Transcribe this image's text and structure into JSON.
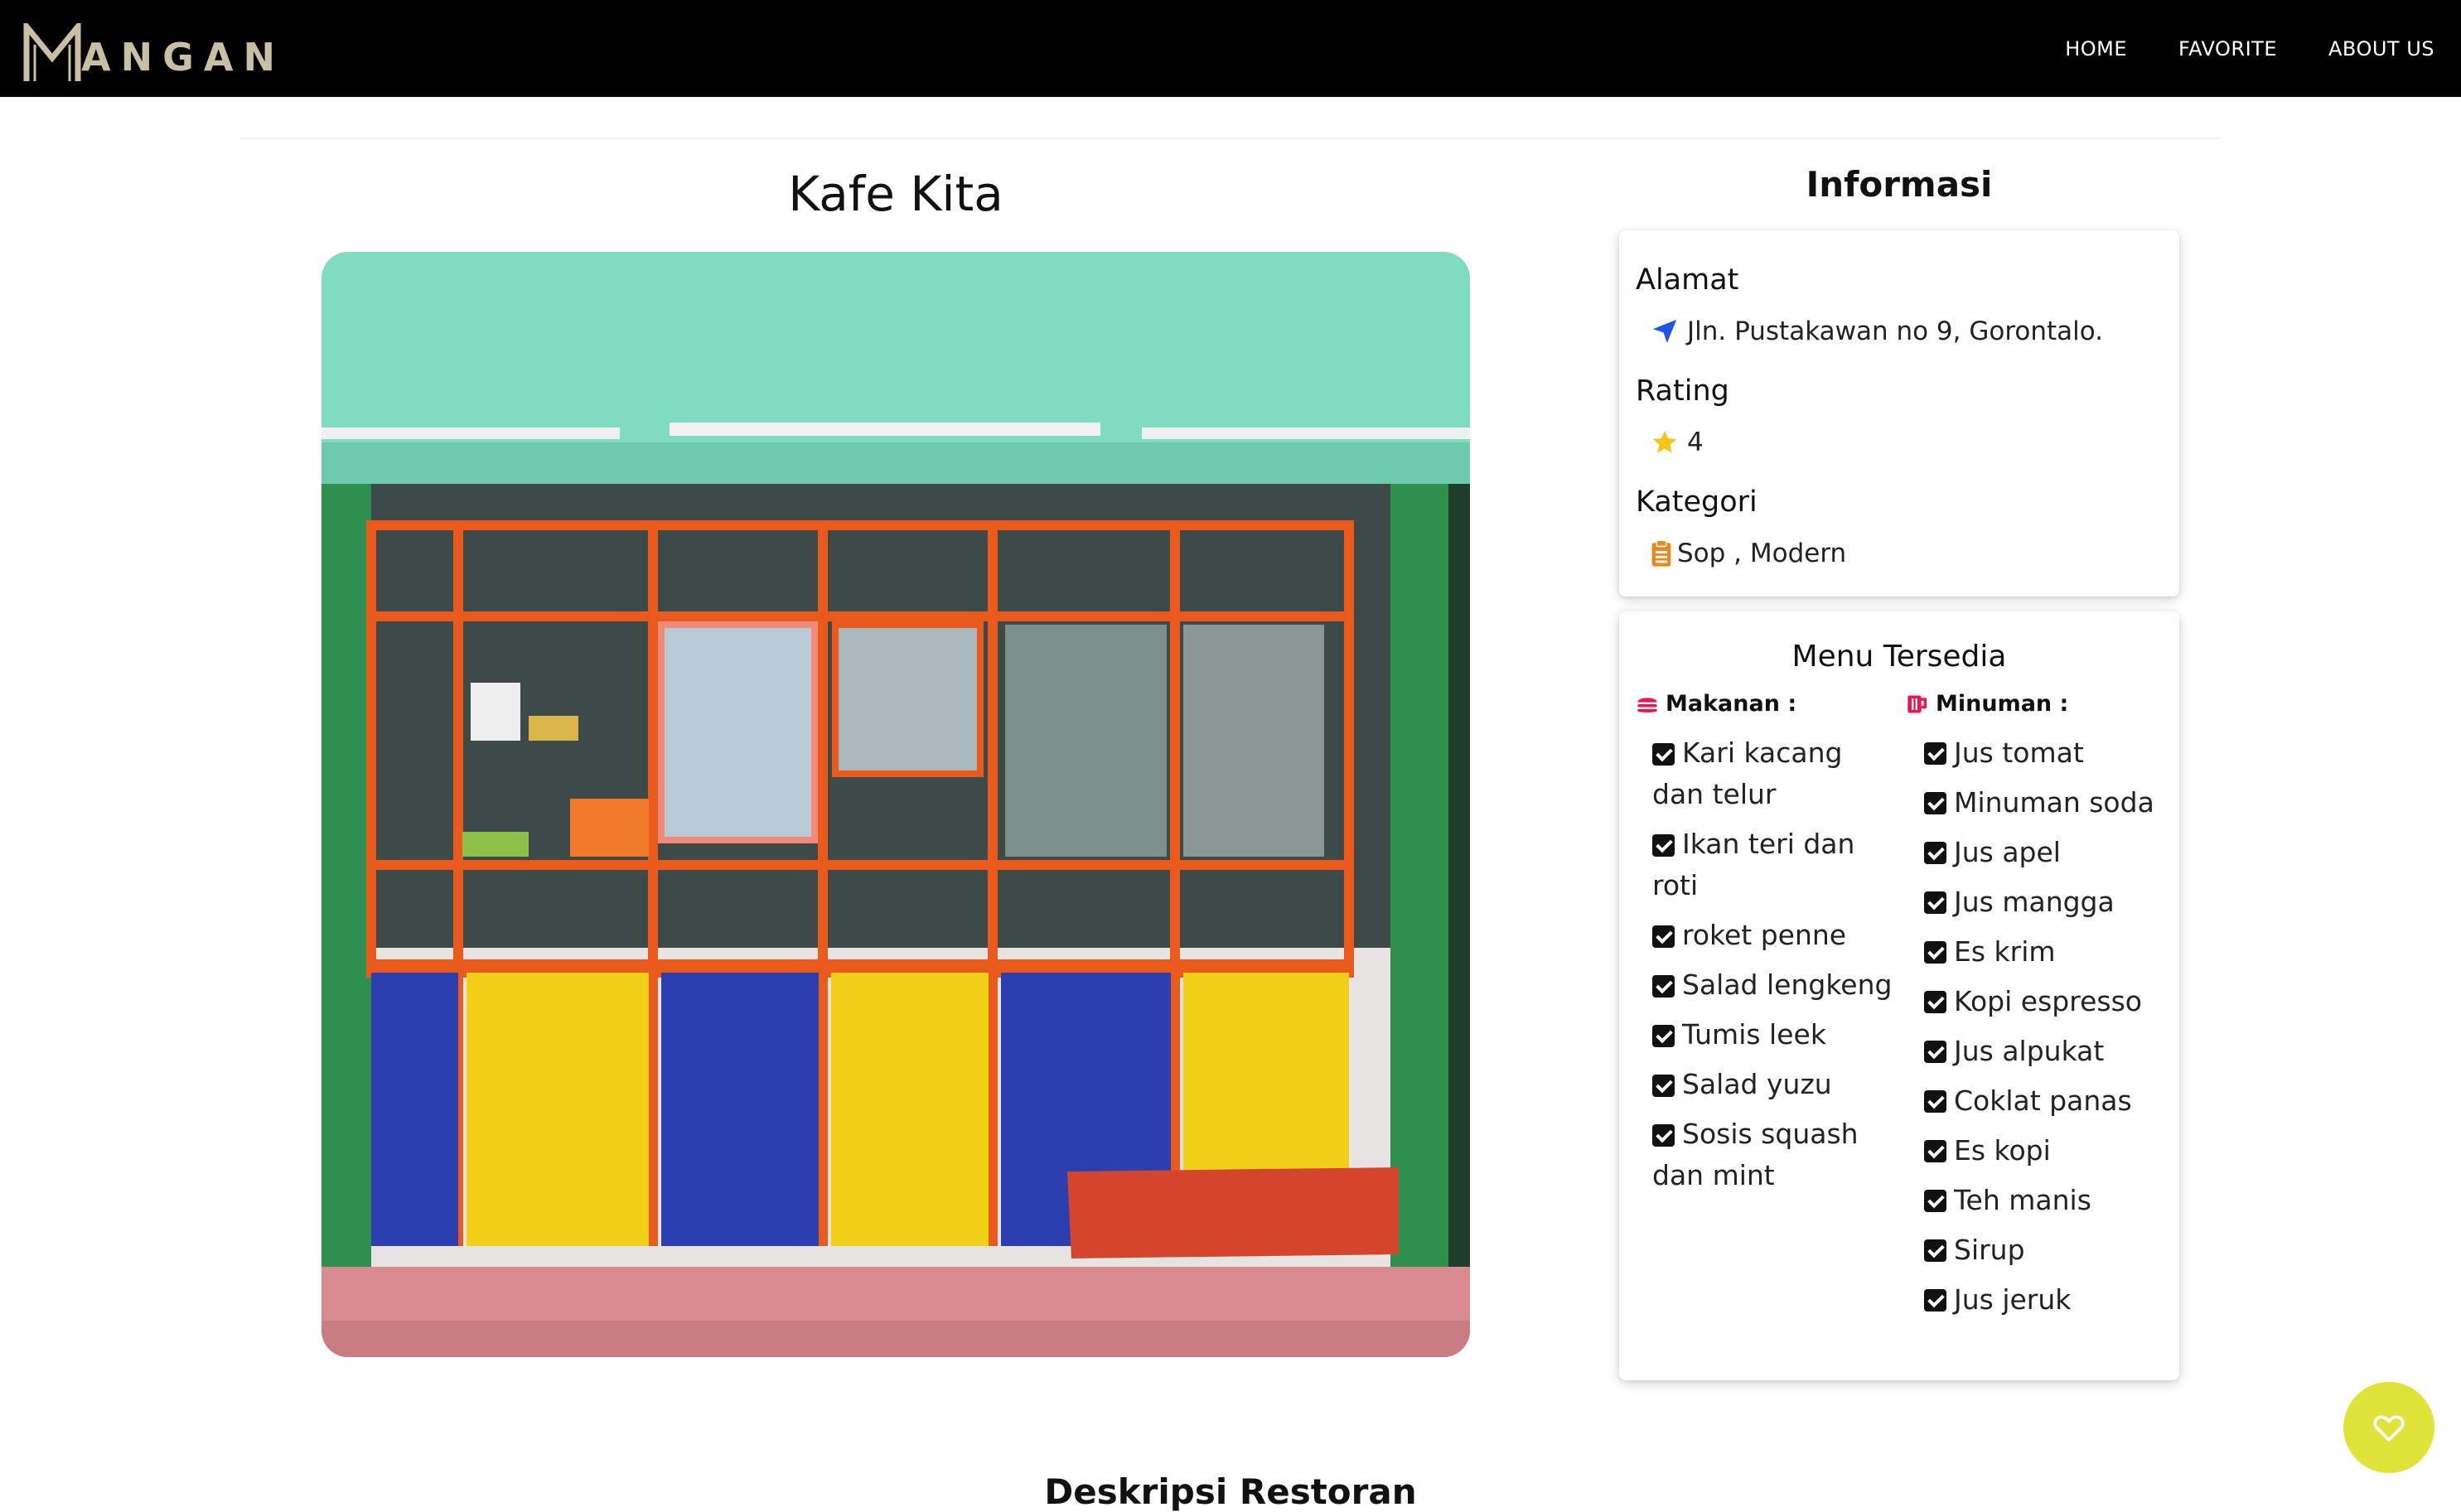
{
  "navbar": {
    "brand": "ANGAN",
    "links": [
      "HOME",
      "FAVORITE",
      "ABOUT US"
    ]
  },
  "restaurant": {
    "name": "Kafe Kita"
  },
  "info": {
    "title": "Informasi",
    "address_label": "Alamat",
    "address": "Jln. Pustakawan no 9, Gorontalo.",
    "rating_label": "Rating",
    "rating": "4",
    "category_label": "Kategori",
    "categories": "Sop , Modern"
  },
  "menu": {
    "title": "Menu Tersedia",
    "food_label": "Makanan :",
    "drink_label": "Minuman :",
    "foods": [
      "Kari kacang dan telur",
      "Ikan teri dan roti",
      "roket penne",
      "Salad lengkeng",
      "Tumis leek",
      "Salad yuzu",
      "Sosis squash dan mint"
    ],
    "drinks": [
      "Jus tomat",
      "Minuman soda",
      "Jus apel",
      "Jus mangga",
      "Es krim",
      "Kopi espresso",
      "Jus alpukat",
      "Coklat panas",
      "Es kopi",
      "Teh manis",
      "Sirup",
      "Jus jeruk"
    ]
  },
  "description": {
    "title": "Deskripsi Restoran"
  },
  "colors": {
    "navbar": "#000000",
    "logo": "#c9bfa5",
    "address_icon": "#1e56e6",
    "star": "#f5c518",
    "category_icon": "#e58a1f",
    "menu_icon": "#e8174f",
    "fab": "#dfe33a"
  },
  "icons": {
    "address": "location-arrow-icon",
    "rating": "star-icon",
    "category": "clipboard-list-icon",
    "food": "hamburger-icon",
    "drink": "mug-icon",
    "check": "check-square-icon",
    "fab": "heart-icon"
  }
}
